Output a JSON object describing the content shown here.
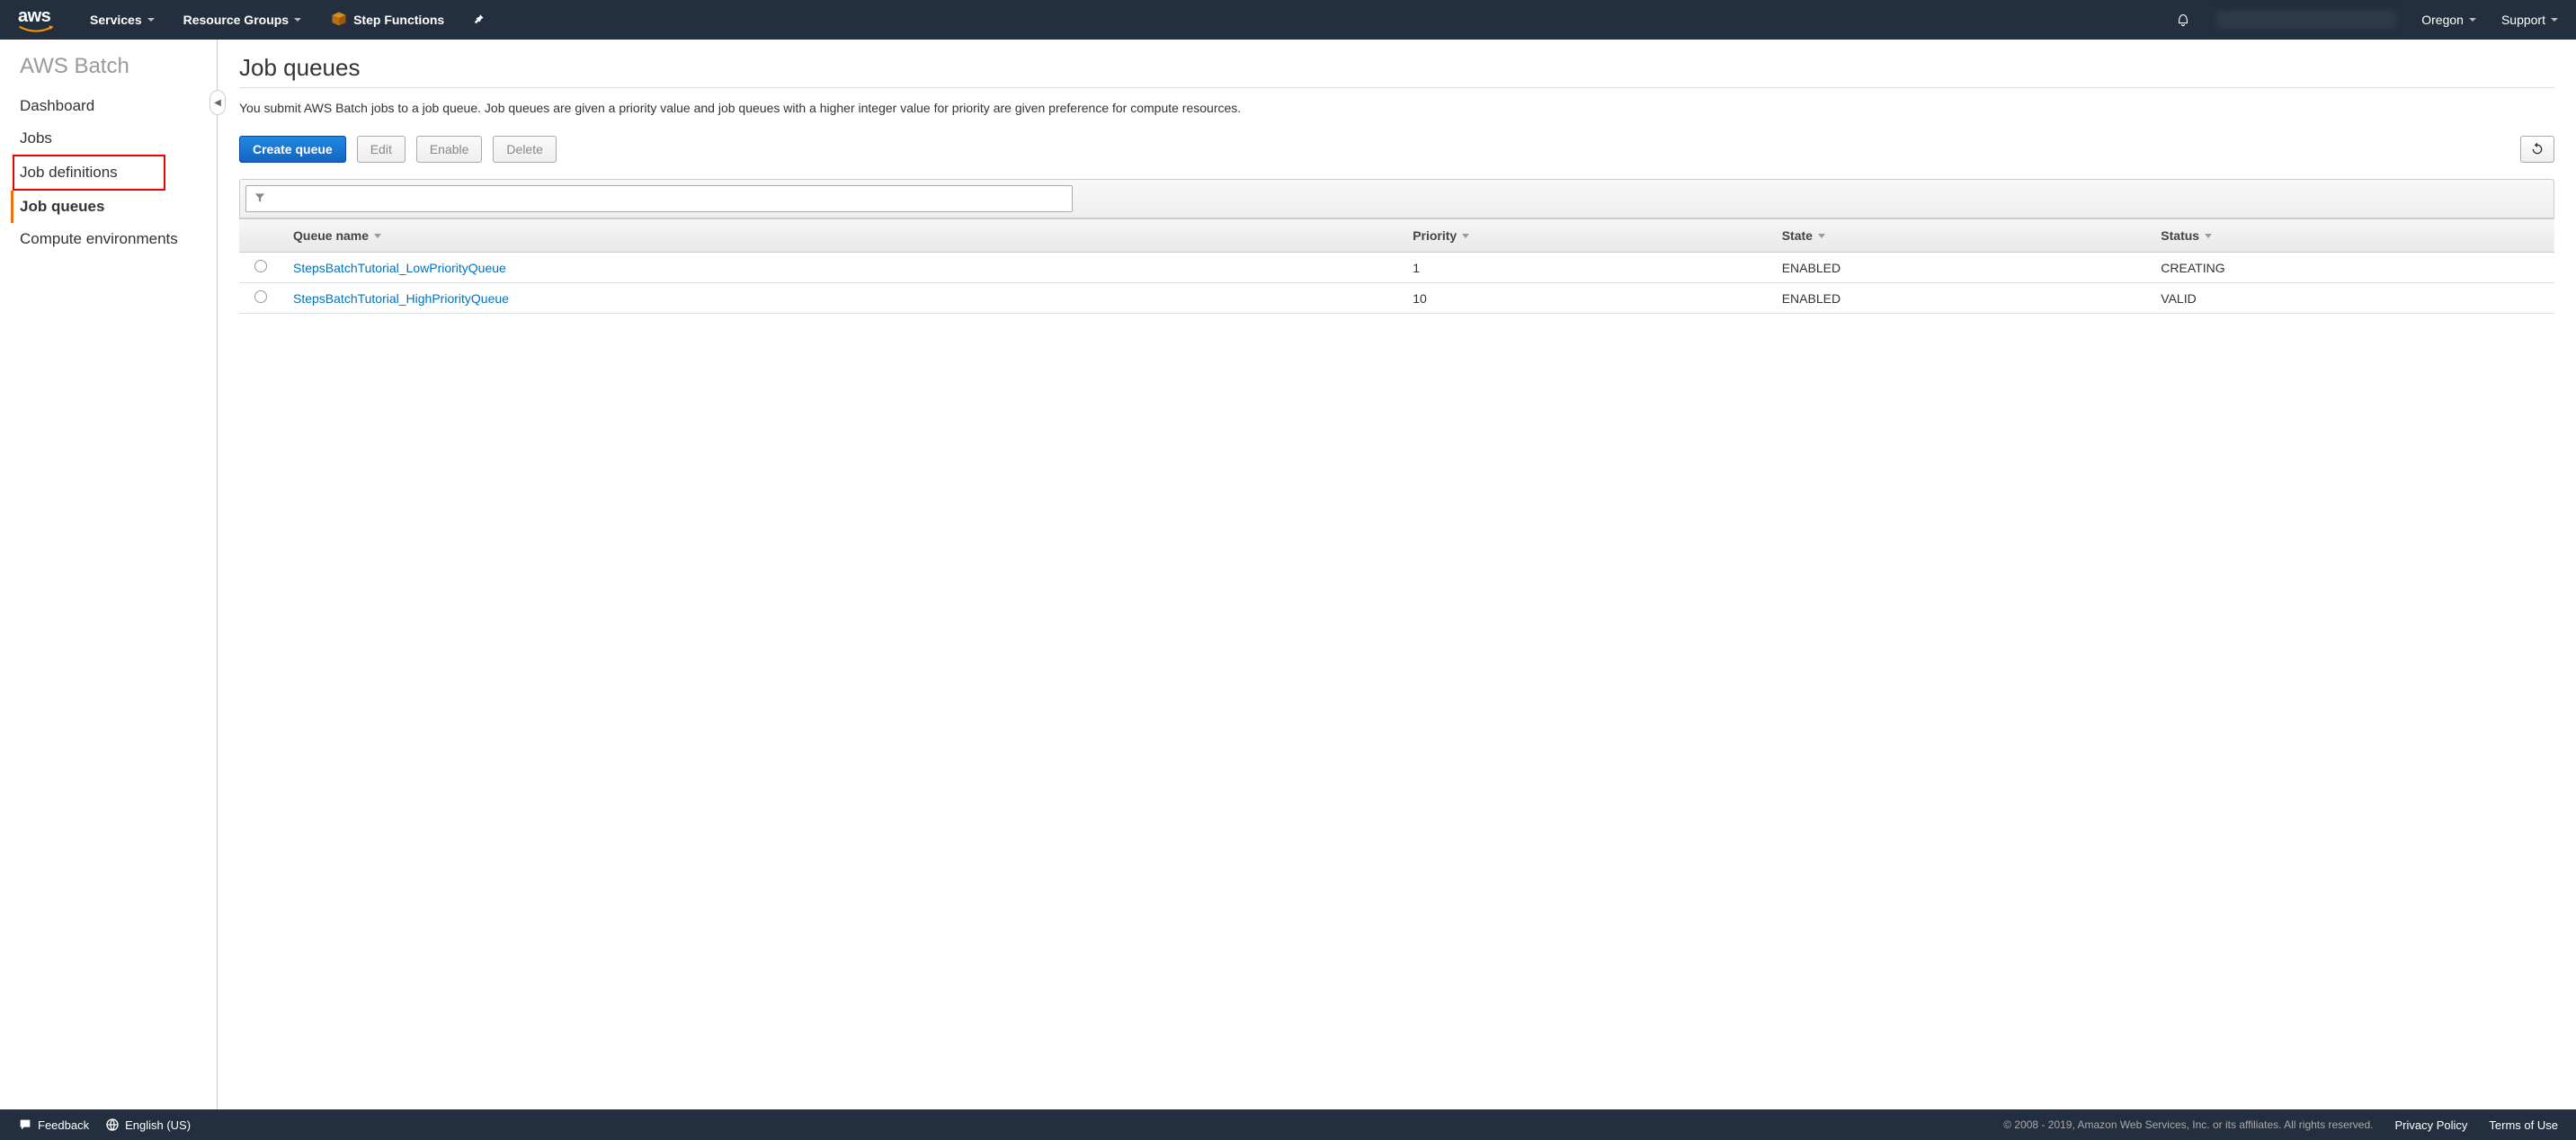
{
  "topnav": {
    "logo_text": "aws",
    "services": "Services",
    "resource_groups": "Resource Groups",
    "step_functions": "Step Functions",
    "region": "Oregon",
    "support": "Support"
  },
  "sidebar": {
    "title": "AWS Batch",
    "items": [
      "Dashboard",
      "Jobs",
      "Job definitions",
      "Job queues",
      "Compute environments"
    ],
    "highlighted_index": 2,
    "active_index": 3
  },
  "main": {
    "title": "Job queues",
    "description": "You submit AWS Batch jobs to a job queue. Job queues are given a priority value and job queues with a higher integer value for priority are given preference for compute resources.",
    "buttons": {
      "create": "Create queue",
      "edit": "Edit",
      "enable": "Enable",
      "delete": "Delete"
    },
    "filter_placeholder": "",
    "columns": {
      "name": "Queue name",
      "priority": "Priority",
      "state": "State",
      "status": "Status"
    },
    "rows": [
      {
        "name": "StepsBatchTutorial_LowPriorityQueue",
        "priority": "1",
        "state": "ENABLED",
        "status": "CREATING"
      },
      {
        "name": "StepsBatchTutorial_HighPriorityQueue",
        "priority": "10",
        "state": "ENABLED",
        "status": "VALID"
      }
    ]
  },
  "footer": {
    "feedback": "Feedback",
    "language": "English (US)",
    "copyright": "© 2008 - 2019, Amazon Web Services, Inc. or its affiliates. All rights reserved.",
    "privacy": "Privacy Policy",
    "terms": "Terms of Use"
  }
}
